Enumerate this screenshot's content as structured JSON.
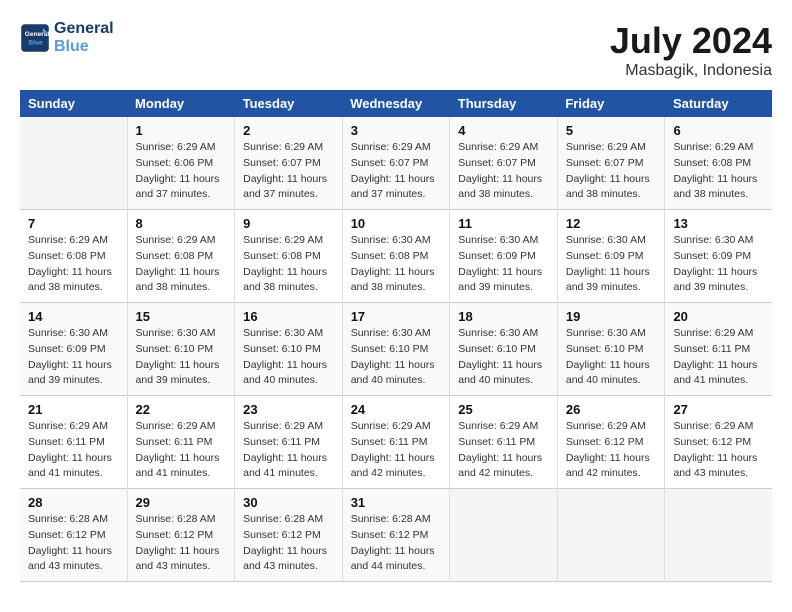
{
  "logo": {
    "line1": "General",
    "line2": "Blue"
  },
  "title": "July 2024",
  "location": "Masbagik, Indonesia",
  "days_header": [
    "Sunday",
    "Monday",
    "Tuesday",
    "Wednesday",
    "Thursday",
    "Friday",
    "Saturday"
  ],
  "weeks": [
    [
      {
        "day": "",
        "info": ""
      },
      {
        "day": "1",
        "info": "Sunrise: 6:29 AM\nSunset: 6:06 PM\nDaylight: 11 hours\nand 37 minutes."
      },
      {
        "day": "2",
        "info": "Sunrise: 6:29 AM\nSunset: 6:07 PM\nDaylight: 11 hours\nand 37 minutes."
      },
      {
        "day": "3",
        "info": "Sunrise: 6:29 AM\nSunset: 6:07 PM\nDaylight: 11 hours\nand 37 minutes."
      },
      {
        "day": "4",
        "info": "Sunrise: 6:29 AM\nSunset: 6:07 PM\nDaylight: 11 hours\nand 38 minutes."
      },
      {
        "day": "5",
        "info": "Sunrise: 6:29 AM\nSunset: 6:07 PM\nDaylight: 11 hours\nand 38 minutes."
      },
      {
        "day": "6",
        "info": "Sunrise: 6:29 AM\nSunset: 6:08 PM\nDaylight: 11 hours\nand 38 minutes."
      }
    ],
    [
      {
        "day": "7",
        "info": "Sunrise: 6:29 AM\nSunset: 6:08 PM\nDaylight: 11 hours\nand 38 minutes."
      },
      {
        "day": "8",
        "info": "Sunrise: 6:29 AM\nSunset: 6:08 PM\nDaylight: 11 hours\nand 38 minutes."
      },
      {
        "day": "9",
        "info": "Sunrise: 6:29 AM\nSunset: 6:08 PM\nDaylight: 11 hours\nand 38 minutes."
      },
      {
        "day": "10",
        "info": "Sunrise: 6:30 AM\nSunset: 6:08 PM\nDaylight: 11 hours\nand 38 minutes."
      },
      {
        "day": "11",
        "info": "Sunrise: 6:30 AM\nSunset: 6:09 PM\nDaylight: 11 hours\nand 39 minutes."
      },
      {
        "day": "12",
        "info": "Sunrise: 6:30 AM\nSunset: 6:09 PM\nDaylight: 11 hours\nand 39 minutes."
      },
      {
        "day": "13",
        "info": "Sunrise: 6:30 AM\nSunset: 6:09 PM\nDaylight: 11 hours\nand 39 minutes."
      }
    ],
    [
      {
        "day": "14",
        "info": "Sunrise: 6:30 AM\nSunset: 6:09 PM\nDaylight: 11 hours\nand 39 minutes."
      },
      {
        "day": "15",
        "info": "Sunrise: 6:30 AM\nSunset: 6:10 PM\nDaylight: 11 hours\nand 39 minutes."
      },
      {
        "day": "16",
        "info": "Sunrise: 6:30 AM\nSunset: 6:10 PM\nDaylight: 11 hours\nand 40 minutes."
      },
      {
        "day": "17",
        "info": "Sunrise: 6:30 AM\nSunset: 6:10 PM\nDaylight: 11 hours\nand 40 minutes."
      },
      {
        "day": "18",
        "info": "Sunrise: 6:30 AM\nSunset: 6:10 PM\nDaylight: 11 hours\nand 40 minutes."
      },
      {
        "day": "19",
        "info": "Sunrise: 6:30 AM\nSunset: 6:10 PM\nDaylight: 11 hours\nand 40 minutes."
      },
      {
        "day": "20",
        "info": "Sunrise: 6:29 AM\nSunset: 6:11 PM\nDaylight: 11 hours\nand 41 minutes."
      }
    ],
    [
      {
        "day": "21",
        "info": "Sunrise: 6:29 AM\nSunset: 6:11 PM\nDaylight: 11 hours\nand 41 minutes."
      },
      {
        "day": "22",
        "info": "Sunrise: 6:29 AM\nSunset: 6:11 PM\nDaylight: 11 hours\nand 41 minutes."
      },
      {
        "day": "23",
        "info": "Sunrise: 6:29 AM\nSunset: 6:11 PM\nDaylight: 11 hours\nand 41 minutes."
      },
      {
        "day": "24",
        "info": "Sunrise: 6:29 AM\nSunset: 6:11 PM\nDaylight: 11 hours\nand 42 minutes."
      },
      {
        "day": "25",
        "info": "Sunrise: 6:29 AM\nSunset: 6:11 PM\nDaylight: 11 hours\nand 42 minutes."
      },
      {
        "day": "26",
        "info": "Sunrise: 6:29 AM\nSunset: 6:12 PM\nDaylight: 11 hours\nand 42 minutes."
      },
      {
        "day": "27",
        "info": "Sunrise: 6:29 AM\nSunset: 6:12 PM\nDaylight: 11 hours\nand 43 minutes."
      }
    ],
    [
      {
        "day": "28",
        "info": "Sunrise: 6:28 AM\nSunset: 6:12 PM\nDaylight: 11 hours\nand 43 minutes."
      },
      {
        "day": "29",
        "info": "Sunrise: 6:28 AM\nSunset: 6:12 PM\nDaylight: 11 hours\nand 43 minutes."
      },
      {
        "day": "30",
        "info": "Sunrise: 6:28 AM\nSunset: 6:12 PM\nDaylight: 11 hours\nand 43 minutes."
      },
      {
        "day": "31",
        "info": "Sunrise: 6:28 AM\nSunset: 6:12 PM\nDaylight: 11 hours\nand 44 minutes."
      },
      {
        "day": "",
        "info": ""
      },
      {
        "day": "",
        "info": ""
      },
      {
        "day": "",
        "info": ""
      }
    ]
  ]
}
